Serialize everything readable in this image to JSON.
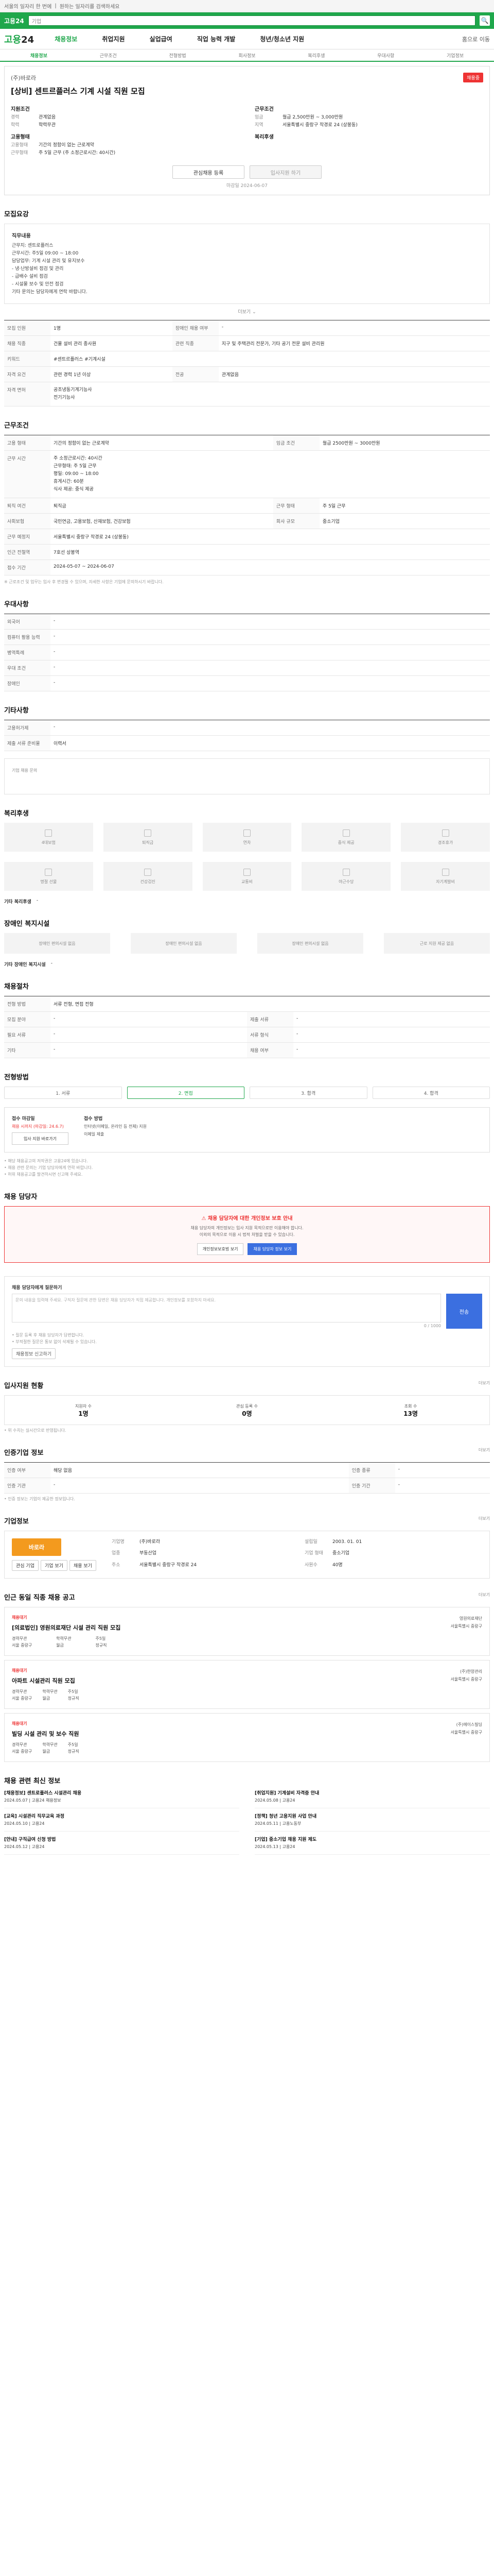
{
  "topbar": {
    "links": [
      "서울의 일자리 한 번에",
      "원하는 일자리를 검색하세요"
    ]
  },
  "search": {
    "logo": "고용24",
    "placeholder": "검색어를 입력하세요",
    "value": "기업"
  },
  "gnb": {
    "brand_a": "고용",
    "brand_b": "24",
    "menu": [
      "채용정보",
      "취업지원",
      "실업급여",
      "직업 능력 개발",
      "청년/청소년 지원"
    ],
    "right": "홈으로 이동"
  },
  "tabs": [
    "채용정보",
    "근무조건",
    "전형방법",
    "회사정보",
    "복리후생",
    "우대사항",
    "기업정보"
  ],
  "head": {
    "company": "(주)바로라",
    "title": "[상비] 센트르플러스 기계 시설 직원 모집",
    "badge": "채용중",
    "left_h": "지원조건",
    "right_h": "근무조건",
    "left": [
      {
        "k": "경력",
        "v": "관계없음"
      },
      {
        "k": "학력",
        "v": "학력무관"
      }
    ],
    "right": [
      {
        "k": "임금",
        "v": "월급 2,500만원 ~ 3,000만원"
      },
      {
        "k": "지역",
        "v": "서울특별시 중랑구 작경로 24 (상봉동)"
      }
    ],
    "left_h2": "고용형태",
    "left2": [
      {
        "k": "고용형태",
        "v": "기간의 정함이 없는 근로계약"
      },
      {
        "k": "근무형태",
        "v": "주 5일 근무 (주 소정근로시간: 40시간)"
      }
    ],
    "right_h2": "복리후생",
    "buttons": [
      "관심채용 등록",
      "입사지원 하기"
    ],
    "deadline": "마감일 2024-06-07"
  },
  "job": {
    "h": "모집요강",
    "body_h": "직무내용",
    "body": "근무지: 센트로플러스\n근무시간: 주5일 09:00 ~ 18:00\n담당업무: 기계 시설 관리 및 유지보수\n- 냉·난방설비 점검 및 관리\n- 급배수 설비 점검\n- 시설물 보수 및 안전 점검\n기타 문의는 담당자에게 연락 바랍니다.",
    "toggle": "더보기 ⌄",
    "rows": [
      {
        "k": "모집 인원",
        "v": "1명",
        "k2": "장애인 채용 여부",
        "v2": "-"
      },
      {
        "k": "채용 직종",
        "v": "건물 설비 관리 종사원",
        "k2": "관련 직종",
        "v2": "지구 및 주택관리 전문가, 기타 공기 전문 설비 관리원"
      },
      {
        "k": "키워드",
        "v": "#센트르플러스 #기계시설"
      },
      {
        "k": "자격 요건",
        "v": "관련 경력 1년 이상",
        "k2": "전공",
        "v2": "관계없음"
      },
      {
        "k": "자격 면허",
        "v": "공조냉동기계기능사\n전기기능사"
      }
    ]
  },
  "cond": {
    "h": "근무조건",
    "rows": [
      {
        "k": "고용 형태",
        "v": "기간의 정함이 없는 근로계약",
        "k2": "임금 조건",
        "v2": "월급 2500만원 ~ 3000만원"
      },
      {
        "k": "근무 시간",
        "v": "주 소정근로시간: 40시간\n근무형태: 주 5일 근무\n평일: 09:00 ~ 18:00\n휴게시간: 60분\n식사 제공: 중식 제공"
      },
      {
        "k": "퇴직 여건",
        "v": "퇴직금",
        "k2": "근무 형태",
        "v2": "주 5일 근무"
      },
      {
        "k": "사회보험",
        "v": "국민연금, 고용보험, 산재보험, 건강보험",
        "k2": "회사 규모",
        "v2": "중소기업"
      },
      {
        "k": "근무 예정지",
        "v": "서울특별시 중랑구 작경로 24 (상봉동)"
      },
      {
        "k": "인근 전철역",
        "v": "7호선 상봉역"
      },
      {
        "k": "접수 기간",
        "v": "2024-05-07 ~ 2024-06-07"
      }
    ],
    "note": "※ 근로조건 및 업무는 입사 후 변경될 수 있으며, 자세한 사항은 기업에 문의하시기 바랍니다."
  },
  "pref": {
    "h": "우대사항",
    "rows": [
      {
        "k": "외국어",
        "v": "-"
      },
      {
        "k": "컴퓨터 활용 능력",
        "v": "-"
      },
      {
        "k": "병역특례",
        "v": "-"
      },
      {
        "k": "우대 조건",
        "v": "-"
      },
      {
        "k": "장애인",
        "v": "-"
      }
    ]
  },
  "etc": {
    "h": "기타사항",
    "rows": [
      {
        "k": "고용허가제",
        "v": "-"
      },
      {
        "k": "제출 서류 준비물",
        "v": "이력서"
      }
    ],
    "link": "기업 채용 문의"
  },
  "welfare": {
    "h": "복리후생",
    "items": [
      "4대보험",
      "퇴직금",
      "연차",
      "중식 제공",
      "경조휴가",
      "명절 선물",
      "건강검진",
      "교통비",
      "야근수당",
      "자기계발비"
    ],
    "extra_h": "기타 복리후생",
    "extra": "-"
  },
  "disabled": {
    "h": "장애인 복지시설",
    "items": [
      "장애인 편의시설 없음",
      "장애인 편의시설 없음",
      "장애인 편의시설 없음",
      "근로 지원 제공 없음"
    ],
    "note_h": "기타 장애인 복지시설",
    "note": "-"
  },
  "process": {
    "h": "채용절차",
    "rows": [
      {
        "k": "전형 방법",
        "v": "서류 전형, 면접 전형",
        "k2": "",
        "v2": ""
      },
      {
        "k": "모집 분야",
        "v": "-",
        "k2": "제출 서류",
        "v2": "-"
      },
      {
        "k": "필요 서류",
        "v": "-",
        "k2": "서류 형식",
        "v2": "-"
      },
      {
        "k": "기타",
        "v": "-",
        "k2": "채용 여부",
        "v2": "-"
      }
    ]
  },
  "howto": {
    "h": "전형방법",
    "steps": [
      "1. 서류",
      "2. 면접",
      "3. 합격",
      "4. 합격"
    ],
    "apply_l": "접수 마감일",
    "apply_l2": "채용 시까지 (마감일: 24.6.7)",
    "apply_btn": "입사 지원 바로가기",
    "apply_r": "접수 방법",
    "apply_r2": "인터넷(이메일, 온라인 등 전체) 지원",
    "apply_r3": "이메일 제출",
    "notes": "• 해당 채용공고의 저작권은 고용24에 있습니다.\n• 채용 관련 문의는 기업 담당자에게 연락 바랍니다.\n• 허위 채용공고를 발견하시면 신고해 주세요."
  },
  "manager": {
    "h": "채용 담당자",
    "warn": "채용 담당자에 대한 개인정보 보호 안내",
    "desc": "채용 담당자의 개인정보는 입사 지원 목적으로만 이용해야 합니다.\n이외의 목적으로 이용 시 법적 처벌을 받을 수 있습니다.",
    "btns": [
      "개인정보보호법 보기",
      "채용 담당자 정보 보기"
    ]
  },
  "report": {
    "h": "채용 담당자에게 질문하기",
    "placeholder": "문의 내용을 입력해 주세요. 구직자 질문에 관한 답변은 채용 담당자가 직접 제공합니다. 개인정보를 포함하지 마세요.",
    "count": "0 / 1000",
    "send": "전송",
    "notes": "• 질문 등록 후 채용 담당자가 답변합니다.\n• 부적절한 질문은 통보 없이 삭제될 수 있습니다.",
    "link": "채용정보 신고하기"
  },
  "similar": {
    "h": "입사지원 현황",
    "more": "더보기",
    "stats": [
      {
        "t": "지원자 수",
        "v": "1명"
      },
      {
        "t": "관심 등록 수",
        "v": "0명"
      },
      {
        "t": "조회 수",
        "v": "13명"
      }
    ],
    "note": "• 위 수치는 실시간으로 반영됩니다."
  },
  "company": {
    "h": "기업정보",
    "more": "더보기",
    "logo": "바로라",
    "name": "(주)바로라",
    "rows": [
      {
        "k": "기업명",
        "v": "(주)바로라"
      },
      {
        "k": "업종",
        "v": "부동산업"
      },
      {
        "k": "주소",
        "v": "서울특별시 중랑구 작경로 24"
      },
      {
        "k": "사원수",
        "v": "40명"
      },
      {
        "k": "설립일",
        "v": "2003. 01. 01"
      },
      {
        "k": "기업 형태",
        "v": "중소기업"
      }
    ],
    "mini_btns": [
      "관심 기업",
      "기업 보기",
      "채용 보기"
    ]
  },
  "info_box": {
    "h": "인증기업 정보",
    "more": "더보기",
    "rows": [
      {
        "k": "인증 여부",
        "v": "해당 없음",
        "k2": "인증 종류",
        "v2": "-"
      },
      {
        "k": "인증 기관",
        "v": "-",
        "k2": "인증 기간",
        "v2": "-"
      }
    ],
    "note": "• 인증 정보는 기업이 제공한 정보입니다."
  },
  "recommend": {
    "h": "인근 동일 직종 채용 공고",
    "more": "더보기",
    "items": [
      {
        "tag": "채용대기",
        "title": "[의료법인] 영원의료재단 시설 관리 직원 모집",
        "meta": [
          "경력무관",
          "학력무관",
          "주5일",
          "서울 중랑구",
          "월급",
          "정규직"
        ],
        "right": "영원의료재단\n서울특별시 중랑구"
      },
      {
        "tag": "채용대기",
        "title": "아파트 시설관리 직원 모집",
        "meta": [
          "경력무관",
          "학력무관",
          "주5일",
          "서울 중랑구",
          "월급",
          "정규직"
        ],
        "right": "(주)한양관리\n서울특별시 중랑구"
      },
      {
        "tag": "채용대기",
        "title": "빌딩 시설 관리 및 보수 직원",
        "meta": [
          "경력무관",
          "학력무관",
          "주5일",
          "서울 중랑구",
          "월급",
          "정규직"
        ],
        "right": "(주)에이스빌딩\n서울특별시 중랑구"
      }
    ]
  },
  "news": {
    "h": "채용 관련 최신 정보",
    "items": [
      {
        "h": "[채용정보] 센트로플러스 시설관리 채용",
        "d": "2024.05.07 | 고용24 채용정보"
      },
      {
        "h": "[취업지원] 기계설비 자격증 안내",
        "d": "2024.05.08 | 고용24"
      },
      {
        "h": "[교육] 시설관리 직무교육 과정",
        "d": "2024.05.10 | 고용24"
      },
      {
        "h": "[정책] 청년 고용지원 사업 안내",
        "d": "2024.05.11 | 고용노동부"
      },
      {
        "h": "[안내] 구직급여 신청 방법",
        "d": "2024.05.12 | 고용24"
      },
      {
        "h": "[기업] 중소기업 채용 지원 제도",
        "d": "2024.05.13 | 고용24"
      }
    ]
  },
  "colors": {
    "brand": "#1fa74b",
    "accent_blue": "#3b6fe0",
    "warning": "#e33333"
  }
}
